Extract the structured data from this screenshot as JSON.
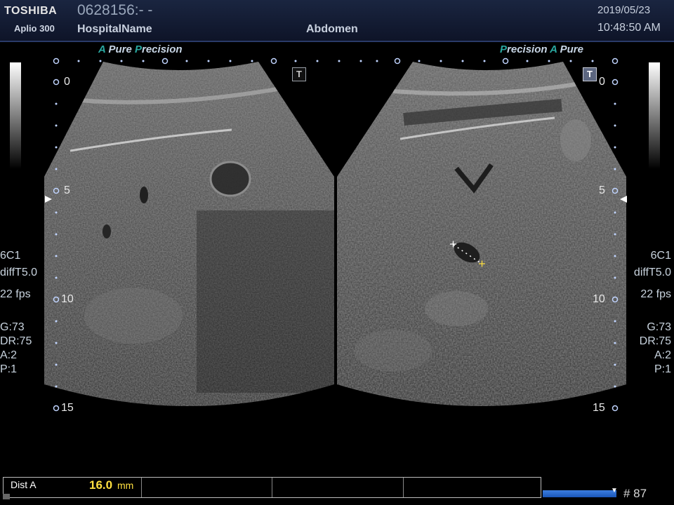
{
  "header": {
    "brand": "TOSHIBA",
    "model": "Aplio 300",
    "patient_id": "0628156:- -",
    "hospital": "HospitalName",
    "exam": "Abdomen",
    "date": "2019/05/23",
    "time": "10:48:50 AM"
  },
  "left_brand": {
    "a": "A",
    "pure": "Pure",
    "p": "P",
    "precision": "recision"
  },
  "right_brand": {
    "p": "P",
    "precision": "recision",
    "a": "A",
    "pure": "Pure"
  },
  "depth_labels": [
    "0",
    "5",
    "10",
    "15"
  ],
  "left_panel": {
    "probe": "6C1",
    "filter": "diffT5.0",
    "fps": "22 fps",
    "gain": "G:73",
    "dr": "DR:75",
    "a": "A:2",
    "p": "P:1",
    "t_button": "T"
  },
  "right_panel": {
    "probe": "6C1",
    "filter": "diffT5.0",
    "fps": "22 fps",
    "gain": "G:73",
    "dr": "DR:75",
    "a": "A:2",
    "p": "P:1",
    "t_button": "T"
  },
  "measurement": {
    "label": "Dist A",
    "value": "16.0",
    "unit": "mm"
  },
  "cine": {
    "frame": "# 87",
    "progress": 1.0
  },
  "colors": {
    "accent_teal": "#2aa8a0",
    "measure_yellow": "#ffe040",
    "header_bg": "#0e1428"
  }
}
